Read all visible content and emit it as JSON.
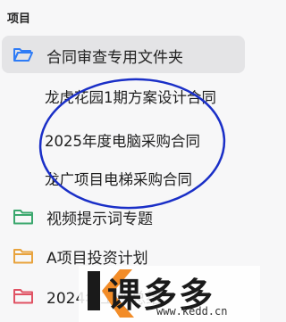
{
  "section": {
    "title": "项目"
  },
  "folders": [
    {
      "label": "合同审查专用文件夹",
      "icon": "folder-open-icon",
      "color": "#2f7cf6",
      "selected": true
    },
    {
      "label": "视频提示词专题",
      "icon": "folder-icon",
      "color": "#3aa76d"
    },
    {
      "label": "A项目投资计划",
      "icon": "folder-icon",
      "color": "#e8a33d"
    },
    {
      "label": "2024年工作总结",
      "icon": "folder-icon",
      "color": "#e05263"
    }
  ],
  "subitems": [
    {
      "label": "龙虎花园1期方案设计合同"
    },
    {
      "label": "2025年度电脑采购合同"
    },
    {
      "label": "龙广项目电梯采购合同"
    }
  ],
  "annotation": {
    "color": "#1a2fc7"
  },
  "watermark": {
    "text": "课多多",
    "url": "www.kedd.cn",
    "color": "#f28c28"
  }
}
